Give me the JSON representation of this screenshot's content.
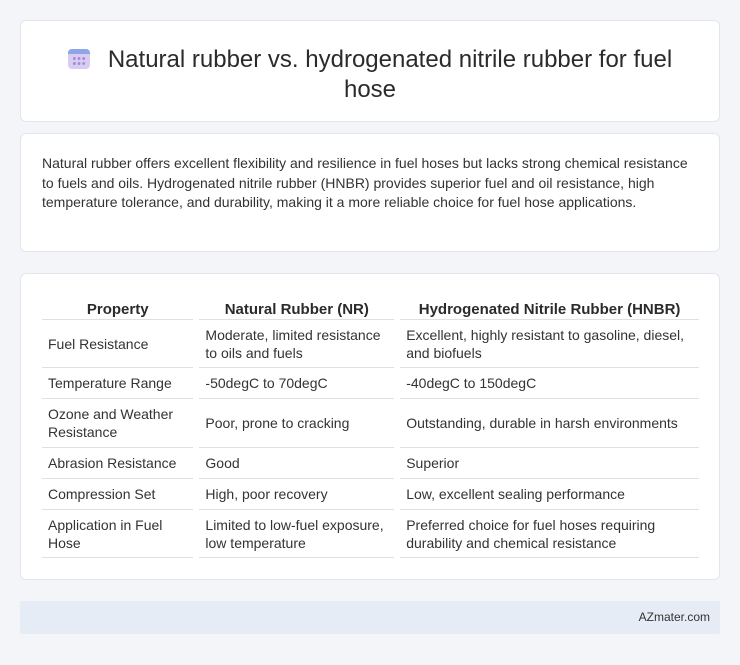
{
  "title": {
    "icon": "calendar-icon",
    "text": "Natural rubber vs. hydrogenated nitrile rubber for fuel hose"
  },
  "intro": "Natural rubber offers excellent flexibility and resilience in fuel hoses but lacks strong chemical resistance to fuels and oils. Hydrogenated nitrile rubber (HNBR) provides superior fuel and oil resistance, high temperature tolerance, and durability, making it a more reliable choice for fuel hose applications.",
  "table": {
    "headers": [
      "Property",
      "Natural Rubber (NR)",
      "Hydrogenated Nitrile Rubber (HNBR)"
    ],
    "rows": [
      [
        "Fuel Resistance",
        "Moderate, limited resistance to oils and fuels",
        "Excellent, highly resistant to gasoline, diesel, and biofuels"
      ],
      [
        "Temperature Range",
        "-50degC to 70degC",
        "-40degC to 150degC"
      ],
      [
        "Ozone and Weather Resistance",
        "Poor, prone to cracking",
        "Outstanding, durable in harsh environments"
      ],
      [
        "Abrasion Resistance",
        "Good",
        "Superior"
      ],
      [
        "Compression Set",
        "High, poor recovery",
        "Low, excellent sealing performance"
      ],
      [
        "Application in Fuel Hose",
        "Limited to low-fuel exposure, low temperature",
        "Preferred choice for fuel hoses requiring durability and chemical resistance"
      ]
    ]
  },
  "footer": {
    "brand": "AZmater.com"
  }
}
